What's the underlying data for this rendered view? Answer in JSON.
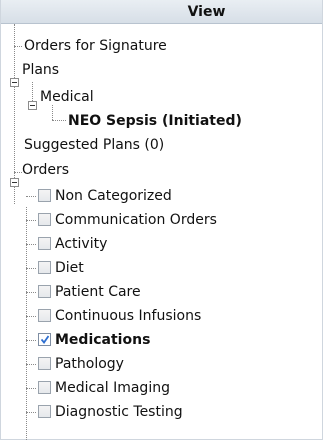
{
  "panel": {
    "header_title": "View"
  },
  "tree": {
    "orders_for_signature": "Orders for Signature",
    "plans": "Plans",
    "medical": "Medical",
    "neo_sepsis": "NEO Sepsis (Initiated)",
    "suggested_plans": "Suggested Plans (0)",
    "orders": "Orders",
    "categories": [
      {
        "label": "Non Categorized",
        "checked": false
      },
      {
        "label": "Communication Orders",
        "checked": false
      },
      {
        "label": "Activity",
        "checked": false
      },
      {
        "label": "Diet",
        "checked": false
      },
      {
        "label": "Patient Care",
        "checked": false
      },
      {
        "label": "Continuous Infusions",
        "checked": false
      },
      {
        "label": "Medications",
        "checked": true
      },
      {
        "label": "Pathology",
        "checked": false
      },
      {
        "label": "Medical Imaging",
        "checked": false
      },
      {
        "label": "Diagnostic Testing",
        "checked": false
      }
    ]
  },
  "colors": {
    "check_mark": "#2e6fd1"
  }
}
